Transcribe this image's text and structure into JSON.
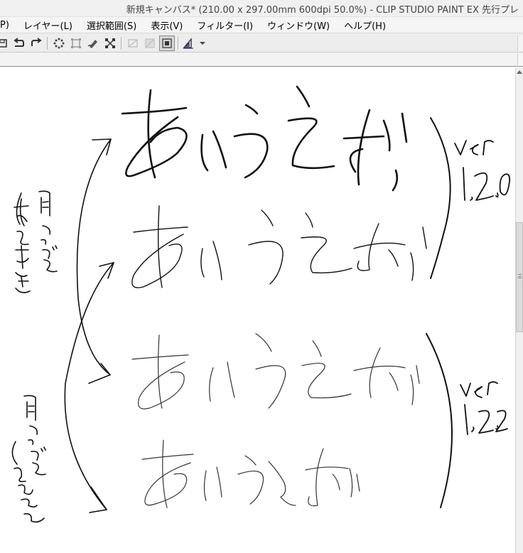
{
  "window": {
    "title": "新規キャンバス* (210.00 x 297.00mm 600dpi 50.0%)  - CLIP STUDIO PAINT EX 先行プレ"
  },
  "menu": {
    "items": [
      "P)",
      "レイヤー(L)",
      "選択範囲(S)",
      "表示(V)",
      "フィルター(I)",
      "ウィンドウ(W)",
      "ヘルプ(H)"
    ]
  },
  "toolbar": {
    "tools": [
      "save-icon",
      "undo-icon",
      "redo-icon",
      "selection-dots-icon",
      "crop-icon",
      "pen-edit-icon",
      "transform-icon",
      "disabled-clear-icon",
      "disabled-fill-icon",
      "selection-frame-icon",
      "ruler-icon"
    ]
  },
  "canvas": {
    "drawing": "handwritten comparison sketch of brush strokes across versions"
  }
}
